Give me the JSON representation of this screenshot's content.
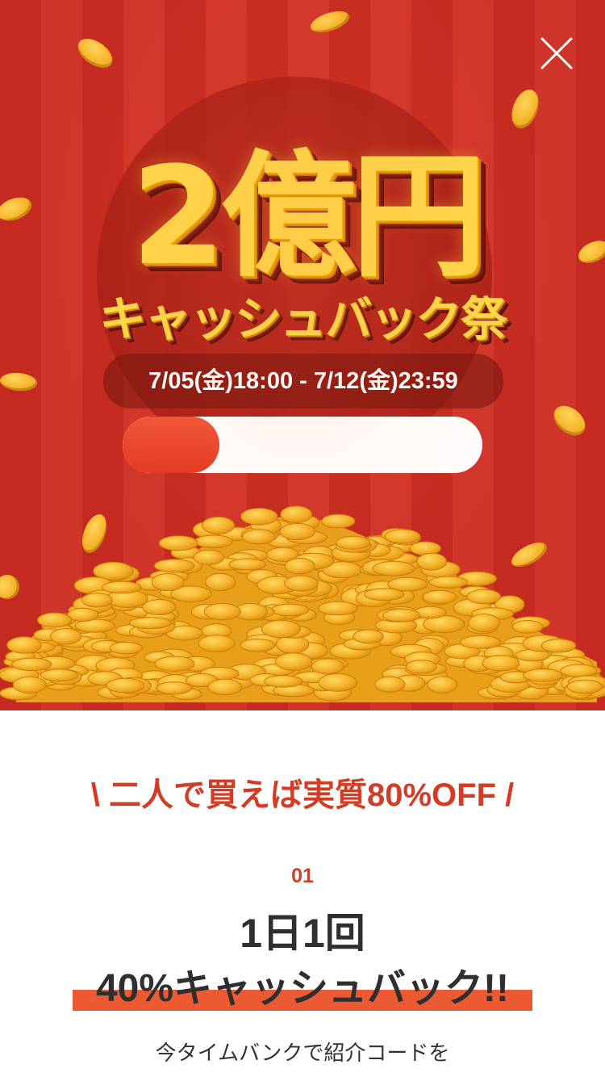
{
  "hero": {
    "title_main": "2億円",
    "title_sub": "キャッシュバック祭",
    "period": "7/05(金)18:00 - 7/12(金)23:59",
    "progress_fraction": 0.27,
    "close_icon": "close-icon"
  },
  "content": {
    "headline": "\\ 二人で買えば実質80%OFF /",
    "step_number": "01",
    "step_title_line1": "1日1回",
    "step_title_line2": "40%キャッシュバック!!",
    "description": "今タイムバンクで紹介コードを"
  },
  "colors": {
    "accent_red": "#d13d25",
    "highlight": "#ec5a33",
    "gold": "#ffd84a",
    "progress_fill": "#e23a20"
  }
}
